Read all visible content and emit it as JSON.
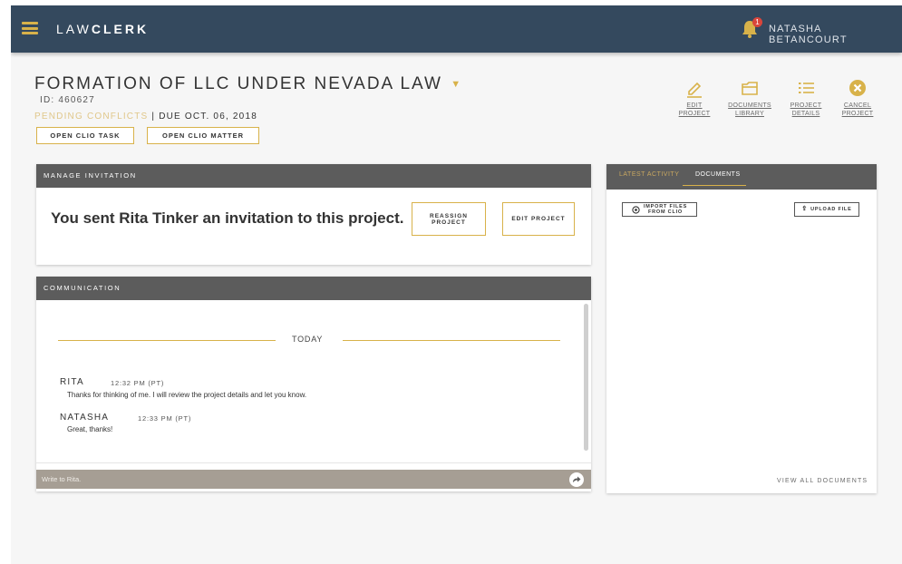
{
  "app": {
    "brand_light": "LAW",
    "brand_bold": "CLERK"
  },
  "header": {
    "notification_count": "1",
    "user_name": "NATASHA BETANCOURT"
  },
  "project": {
    "title": "FORMATION OF LLC UNDER NEVADA LAW",
    "id": "ID: 460627",
    "status": "PENDING CONFLICTS",
    "separator": " | ",
    "due": "DUE OCT. 06, 2018",
    "open_task_label": "OPEN CLIO TASK",
    "open_matter_label": "OPEN CLIO MATTER"
  },
  "actions": [
    {
      "line1": "EDIT",
      "line2": "PROJECT",
      "icon": "pencil-icon"
    },
    {
      "line1": "DOCUMENTS",
      "line2": "LIBRARY",
      "icon": "folder-icon"
    },
    {
      "line1": "PROJECT",
      "line2": "DETAILS",
      "icon": "list-icon"
    },
    {
      "line1": "CANCEL",
      "line2": "PROJECT",
      "icon": "cancel-icon"
    }
  ],
  "invitation": {
    "heading": "MANAGE INVITATION",
    "message": "You sent Rita Tinker an invitation to this project.",
    "reassign_line1": "REASSIGN",
    "reassign_line2": "PROJECT",
    "edit_label": "EDIT PROJECT"
  },
  "communication": {
    "heading": "COMMUNICATION",
    "day_label": "TODAY",
    "messages": [
      {
        "name": "RITA",
        "time": "12:32 PM (PT)",
        "text": "Thanks for thinking of me. I will review the project details and let you know."
      },
      {
        "name": "NATASHA",
        "time": "12:33 PM (PT)",
        "text": "Great, thanks!"
      }
    ],
    "input_placeholder": "Write to Rita."
  },
  "documents_panel": {
    "tabs": [
      "LATEST ACTIVITY",
      "DOCUMENTS"
    ],
    "active_tab": "DOCUMENTS",
    "import_line1": "IMPORT FILES",
    "import_line2": "FROM CLIO",
    "upload_label": "UPLOAD FILE",
    "view_all_label": "VIEW ALL DOCUMENTS"
  },
  "colors": {
    "topbar": "#34495e",
    "accent": "#d8b24a",
    "panel_header": "#5c5c5c",
    "cancel_icon": "#d8b24a",
    "badge": "#d9453b"
  }
}
